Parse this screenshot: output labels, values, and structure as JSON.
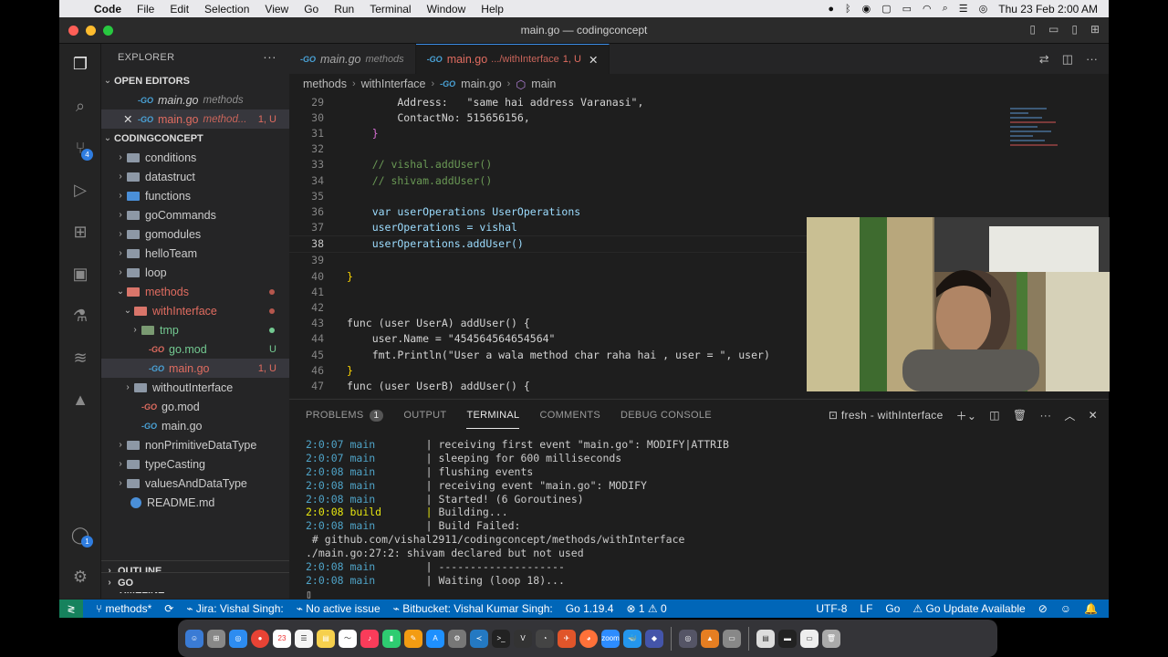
{
  "menubar": {
    "app": "Code",
    "items": [
      "File",
      "Edit",
      "Selection",
      "View",
      "Go",
      "Run",
      "Terminal",
      "Window",
      "Help"
    ],
    "clock": "Thu 23 Feb  2:00 AM"
  },
  "window": {
    "title": "main.go — codingconcept"
  },
  "explorer": {
    "header": "EXPLORER",
    "open_editors": "OPEN EDITORS",
    "open_files": [
      {
        "name": "main.go",
        "desc": "methods"
      },
      {
        "name": "main.go",
        "desc": "method...",
        "status": "1, U"
      }
    ],
    "project": "CODINGCONCEPT",
    "tree": [
      {
        "label": "conditions"
      },
      {
        "label": "datastruct"
      },
      {
        "label": "functions"
      },
      {
        "label": "goCommands"
      },
      {
        "label": "gomodules"
      },
      {
        "label": "helloTeam"
      },
      {
        "label": "loop"
      },
      {
        "label": "methods"
      },
      {
        "label": "withInterface"
      },
      {
        "label": "tmp"
      },
      {
        "label": "go.mod",
        "status": "U"
      },
      {
        "label": "main.go",
        "status": "1, U"
      },
      {
        "label": "withoutInterface"
      },
      {
        "label": "go.mod"
      },
      {
        "label": "main.go"
      },
      {
        "label": "nonPrimitiveDataType"
      },
      {
        "label": "typeCasting"
      },
      {
        "label": "valuesAndDataType"
      },
      {
        "label": "README.md"
      }
    ],
    "outline": "OUTLINE",
    "timeline": "TIMELINE",
    "go": "GO"
  },
  "tabs": [
    {
      "label": "main.go",
      "desc": "methods"
    },
    {
      "label": "main.go",
      "desc": ".../withInterface",
      "status": "1, U"
    }
  ],
  "breadcrumb": [
    "methods",
    "withInterface",
    "main.go",
    "main"
  ],
  "code_lines": [
    {
      "n": "29",
      "text": "        Address:   \"same hai address Varanasi\","
    },
    {
      "n": "30",
      "text": "        ContactNo: 515656156,"
    },
    {
      "n": "31",
      "text": "    }"
    },
    {
      "n": "32",
      "text": ""
    },
    {
      "n": "33",
      "text": "    // vishal.addUser()"
    },
    {
      "n": "34",
      "text": "    // shivam.addUser()"
    },
    {
      "n": "35",
      "text": ""
    },
    {
      "n": "36",
      "text": "    var userOperations UserOperations"
    },
    {
      "n": "37",
      "text": "    userOperations = vishal"
    },
    {
      "n": "38",
      "text": "    userOperations.addUser()"
    },
    {
      "n": "39",
      "text": ""
    },
    {
      "n": "40",
      "text": "}"
    },
    {
      "n": "41",
      "text": ""
    },
    {
      "n": "42",
      "text": ""
    },
    {
      "n": "43",
      "text": "func (user UserA) addUser() {"
    },
    {
      "n": "44",
      "text": "    user.Name = \"454564564654564\""
    },
    {
      "n": "45",
      "text": "    fmt.Println(\"User a wala method char raha hai , user = \", user)"
    },
    {
      "n": "46",
      "text": "}"
    },
    {
      "n": "47",
      "text": "func (user UserB) addUser() {"
    }
  ],
  "panel": {
    "tabs": [
      "PROBLEMS",
      "OUTPUT",
      "TERMINAL",
      "COMMENTS",
      "DEBUG CONSOLE"
    ],
    "problems_count": "1",
    "terminal_name": "fresh - withInterface"
  },
  "terminal_lines": [
    {
      "time": "2:0:07",
      "src": "main",
      "msg": "receiving first event \"main.go\": MODIFY|ATTRIB"
    },
    {
      "time": "2:0:07",
      "src": "main",
      "msg": "sleeping for 600 milliseconds"
    },
    {
      "time": "2:0:08",
      "src": "main",
      "msg": "flushing events"
    },
    {
      "time": "2:0:08",
      "src": "main",
      "msg": "receiving event \"main.go\": MODIFY"
    },
    {
      "time": "2:0:08",
      "src": "main",
      "msg": "Started! (6 Goroutines)"
    },
    {
      "time": "2:0:08",
      "src": "build",
      "msg": "Building..."
    },
    {
      "time": "2:0:08",
      "src": "main",
      "msg": "Build Failed:"
    },
    {
      "raw": " # github.com/vishal2911/codingconcept/methods/withInterface"
    },
    {
      "raw": "./main.go:27:2: shivam declared but not used"
    },
    {
      "time": "2:0:08",
      "src": "main",
      "msg": "--------------------"
    },
    {
      "time": "2:0:08",
      "src": "main",
      "msg": "Waiting (loop 18)..."
    }
  ],
  "status": {
    "branch": "methods*",
    "jira": "Jira: Vishal  Singh:",
    "issue": "No active issue",
    "bitbucket": "Bitbucket: Vishal Kumar Singh:",
    "go_version": "Go 1.19.4",
    "problems": "⊗ 1 ⚠ 0",
    "encoding": "UTF-8",
    "eol": "LF",
    "lang": "Go",
    "update": "Go Update Available"
  }
}
